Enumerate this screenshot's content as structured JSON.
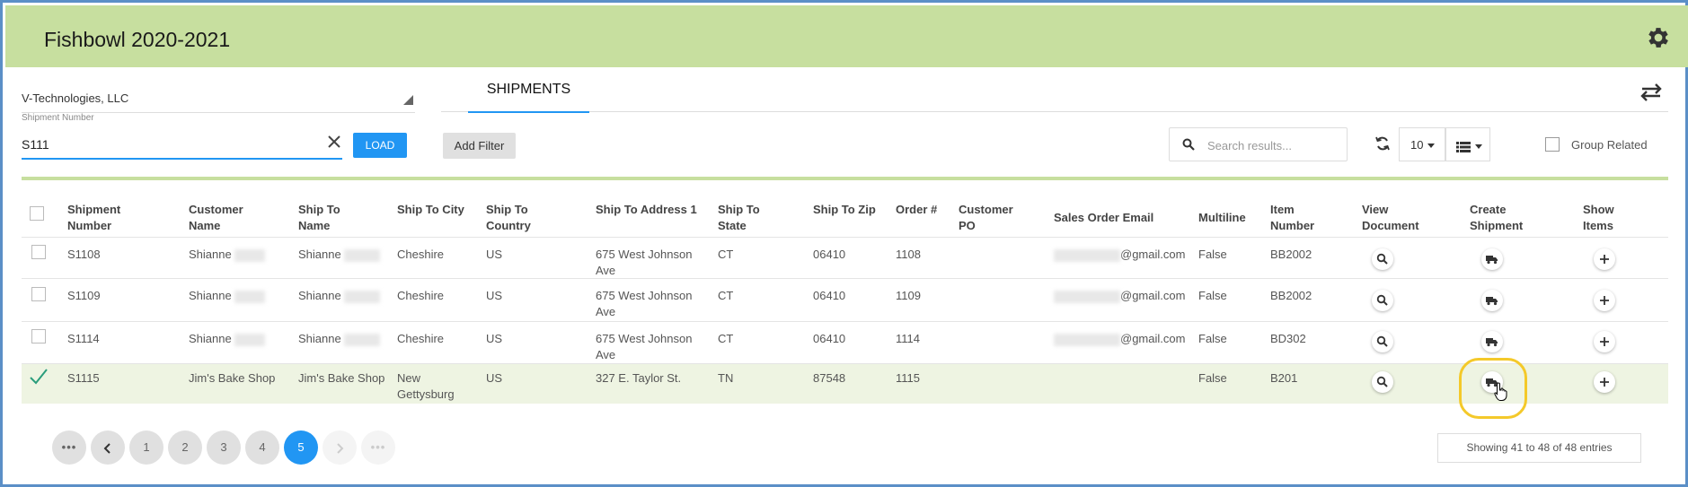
{
  "app": {
    "title": "Fishbowl 2020-2021"
  },
  "left": {
    "company": "V-Technologies, LLC",
    "shipment_label": "Shipment Number",
    "shipment_value": "S111",
    "load_label": "LOAD"
  },
  "tabs": {
    "shipments": "SHIPMENTS"
  },
  "toolbar": {
    "add_filter": "Add Filter",
    "search_placeholder": "Search results...",
    "page_size": "10",
    "group_related": "Group Related"
  },
  "table": {
    "headers": {
      "shipment_number": "Shipment Number",
      "customer_name": "Customer Name",
      "ship_to_name": "Ship To Name",
      "ship_to_city": "Ship To City",
      "ship_to_country": "Ship To Country",
      "ship_to_address": "Ship To Address 1",
      "ship_to_state": "Ship To State",
      "ship_to_zip": "Ship To Zip",
      "order_no": "Order #",
      "customer_po": "Customer PO",
      "sales_order_email": "Sales Order Email",
      "multiline": "Multiline",
      "item_number": "Item Number",
      "view_document": "View Document",
      "create_shipment": "Create Shipment",
      "show_items": "Show Items"
    },
    "rows": [
      {
        "shipment": "S1108",
        "customer": "Shianne",
        "ship_to_name": "Shianne",
        "city": "Cheshire",
        "country": "US",
        "address": "675 West Johnson Ave",
        "state": "CT",
        "zip": "06410",
        "order": "1108",
        "po": "",
        "email": "@gmail.com",
        "multiline": "False",
        "item": "BB2002"
      },
      {
        "shipment": "S1109",
        "customer": "Shianne",
        "ship_to_name": "Shianne",
        "city": "Cheshire",
        "country": "US",
        "address": "675 West Johnson Ave",
        "state": "CT",
        "zip": "06410",
        "order": "1109",
        "po": "",
        "email": "@gmail.com",
        "multiline": "False",
        "item": "BB2002"
      },
      {
        "shipment": "S1114",
        "customer": "Shianne",
        "ship_to_name": "Shianne",
        "city": "Cheshire",
        "country": "US",
        "address": "675 West Johnson Ave",
        "state": "CT",
        "zip": "06410",
        "order": "1114",
        "po": "",
        "email": "@gmail.com",
        "multiline": "False",
        "item": "BD302"
      },
      {
        "shipment": "S1115",
        "customer": "Jim's Bake Shop",
        "ship_to_name": "Jim's Bake Shop",
        "city": "New Gettysburg",
        "country": "US",
        "address": "327 E. Taylor St.",
        "state": "TN",
        "zip": "87548",
        "order": "1115",
        "po": "",
        "email": "",
        "multiline": "False",
        "item": "B201"
      }
    ]
  },
  "pagination": {
    "pages": [
      "1",
      "2",
      "3",
      "4",
      "5"
    ],
    "active": "5",
    "entries": "Showing 41 to 48 of 48 entries"
  },
  "colors": {
    "header_bg": "#c7df9f",
    "accent": "#2196f3",
    "highlight": "#f4c92a",
    "selected_row": "#eef4e2"
  }
}
